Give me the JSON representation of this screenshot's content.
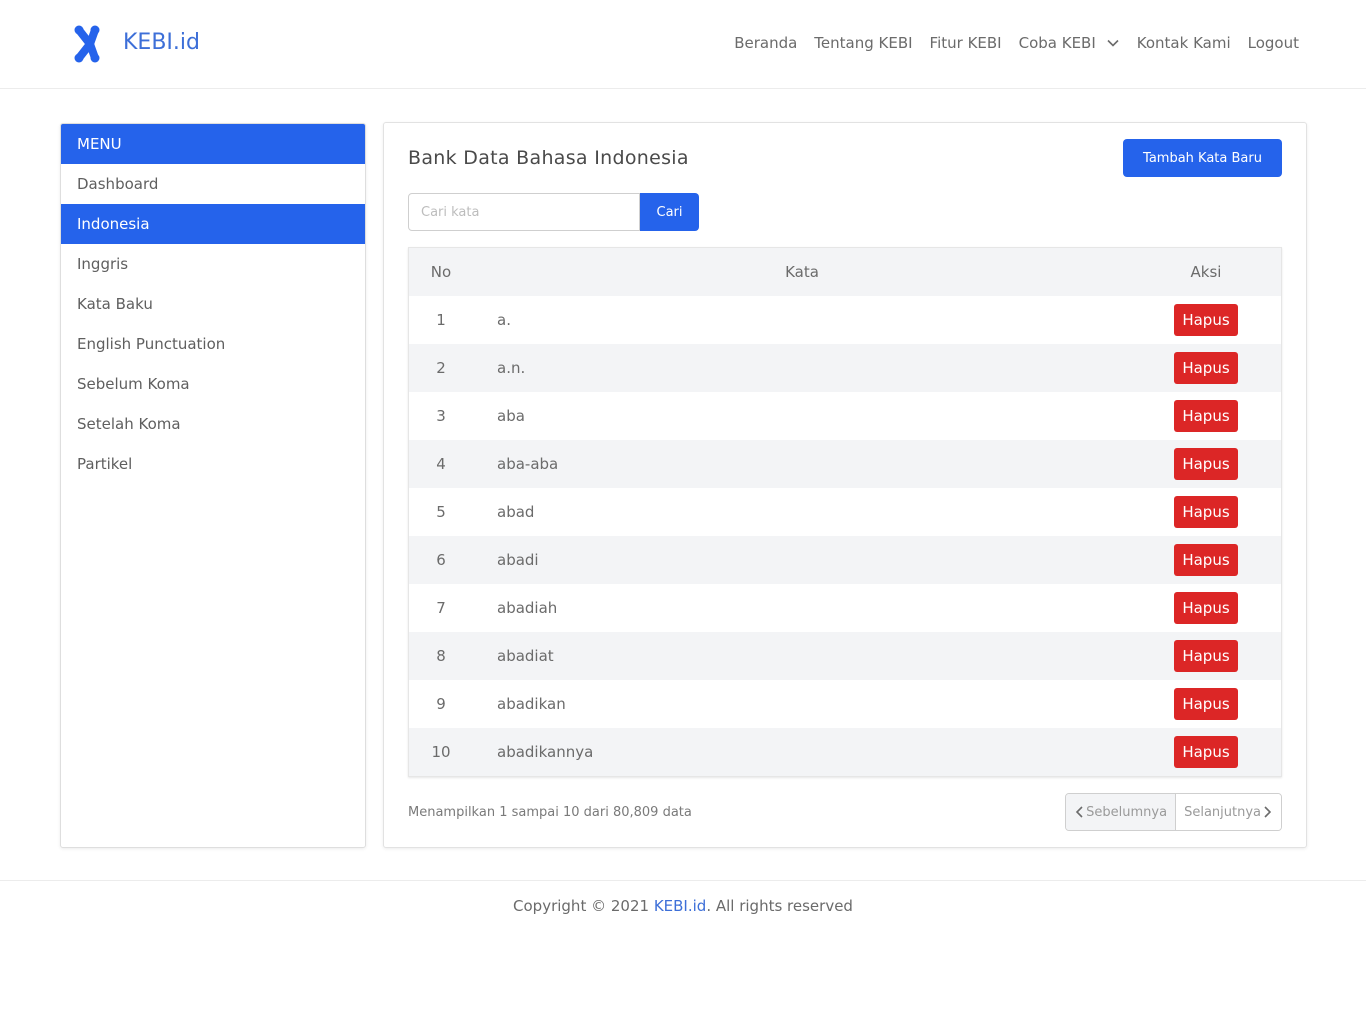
{
  "brand": {
    "name": "KEBI.id",
    "logo_icon": "kebi-x-logo-icon",
    "color": "#2563eb"
  },
  "nav": {
    "items": [
      "Beranda",
      "Tentang KEBI",
      "Fitur KEBI",
      "Coba KEBI",
      "Kontak Kami",
      "Logout"
    ],
    "dropdown_icon": "chevron-down-icon"
  },
  "sidebar": {
    "heading": "MENU",
    "items": [
      {
        "label": "Dashboard",
        "active": false
      },
      {
        "label": "Indonesia",
        "active": true
      },
      {
        "label": "Inggris",
        "active": false
      },
      {
        "label": "Kata Baku",
        "active": false
      },
      {
        "label": "English Punctuation",
        "active": false
      },
      {
        "label": "Sebelum Koma",
        "active": false
      },
      {
        "label": "Setelah Koma",
        "active": false
      },
      {
        "label": "Partikel",
        "active": false
      }
    ]
  },
  "main": {
    "title": "Bank Data Bahasa Indonesia",
    "add_button": "Tambah Kata Baru",
    "search": {
      "placeholder": "Cari kata",
      "value": "",
      "button": "Cari"
    },
    "table": {
      "headers": [
        "No",
        "Kata",
        "Aksi"
      ],
      "rows": [
        {
          "no": "1",
          "kata": "a.",
          "aksi": "Hapus"
        },
        {
          "no": "2",
          "kata": "a.n.",
          "aksi": "Hapus"
        },
        {
          "no": "3",
          "kata": "aba",
          "aksi": "Hapus"
        },
        {
          "no": "4",
          "kata": "aba-aba",
          "aksi": "Hapus"
        },
        {
          "no": "5",
          "kata": "abad",
          "aksi": "Hapus"
        },
        {
          "no": "6",
          "kata": "abadi",
          "aksi": "Hapus"
        },
        {
          "no": "7",
          "kata": "abadiah",
          "aksi": "Hapus"
        },
        {
          "no": "8",
          "kata": "abadiat",
          "aksi": "Hapus"
        },
        {
          "no": "9",
          "kata": "abadikan",
          "aksi": "Hapus"
        },
        {
          "no": "10",
          "kata": "abadikannya",
          "aksi": "Hapus"
        }
      ]
    },
    "info": "Menampilkan 1 sampai 10 dari 80,809 data",
    "pagination": {
      "prev": "Sebelumnya",
      "next": "Selanjutnya"
    }
  },
  "footer": {
    "prefix": "Copyright © 2021 ",
    "brand": "KEBI.id",
    "suffix": ". All rights reserved"
  },
  "colors": {
    "primary": "#2563eb",
    "danger": "#dc2626",
    "stripe": "#f3f4f6"
  }
}
